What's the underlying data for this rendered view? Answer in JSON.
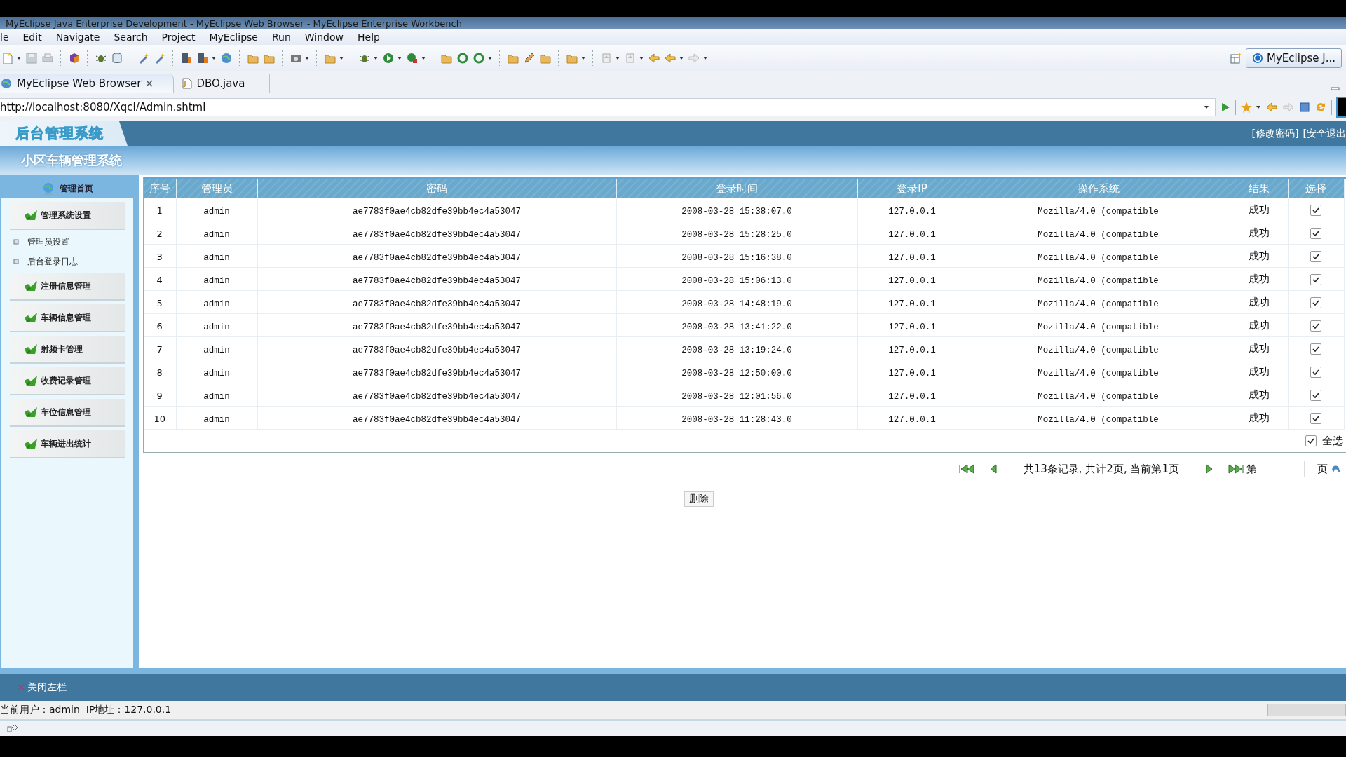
{
  "window": {
    "title": "MyEclipse Java Enterprise Development - MyEclipse Web Browser - MyEclipse Enterprise Workbench"
  },
  "menu": [
    "le",
    "Edit",
    "Navigate",
    "Search",
    "Project",
    "MyEclipse",
    "Run",
    "Window",
    "Help"
  ],
  "toolbar": {
    "perspective_button": "MyEclipse J..."
  },
  "tabs": [
    {
      "label": "MyEclipse Web Browser",
      "selected": true
    },
    {
      "label": "DBO.java",
      "selected": false
    }
  ],
  "address_bar": {
    "value": "http://localhost:8080/Xqcl/Admin.shtml"
  },
  "app": {
    "logo": "后台管理系统",
    "header_links": [
      "[修改密码]",
      "[安全退出"
    ],
    "subtitle": "小区车辆管理系统"
  },
  "sidebar": {
    "home": "管理首页",
    "items": [
      {
        "label": "管理系统设置",
        "children": [
          {
            "label": "管理员设置"
          },
          {
            "label": "后台登录日志"
          }
        ]
      },
      {
        "label": "注册信息管理"
      },
      {
        "label": "车辆信息管理"
      },
      {
        "label": "射频卡管理"
      },
      {
        "label": "收费记录管理"
      },
      {
        "label": "车位信息管理"
      },
      {
        "label": "车辆进出统计"
      }
    ]
  },
  "table": {
    "columns": [
      "序号",
      "管理员",
      "密码",
      "登录时间",
      "登录IP",
      "操作系统",
      "结果",
      "选择"
    ],
    "rows": [
      {
        "cells": [
          "1",
          "admin",
          "ae7783f0ae4cb82dfe39bb4ec4a53047",
          "2008-03-28 15:38:07.0",
          "127.0.0.1",
          "Mozilla/4.0 (compatible",
          "成功"
        ],
        "checked": true
      },
      {
        "cells": [
          "2",
          "admin",
          "ae7783f0ae4cb82dfe39bb4ec4a53047",
          "2008-03-28 15:28:25.0",
          "127.0.0.1",
          "Mozilla/4.0 (compatible",
          "成功"
        ],
        "checked": true
      },
      {
        "cells": [
          "3",
          "admin",
          "ae7783f0ae4cb82dfe39bb4ec4a53047",
          "2008-03-28 15:16:38.0",
          "127.0.0.1",
          "Mozilla/4.0 (compatible",
          "成功"
        ],
        "checked": true
      },
      {
        "cells": [
          "4",
          "admin",
          "ae7783f0ae4cb82dfe39bb4ec4a53047",
          "2008-03-28 15:06:13.0",
          "127.0.0.1",
          "Mozilla/4.0 (compatible",
          "成功"
        ],
        "checked": true
      },
      {
        "cells": [
          "5",
          "admin",
          "ae7783f0ae4cb82dfe39bb4ec4a53047",
          "2008-03-28 14:48:19.0",
          "127.0.0.1",
          "Mozilla/4.0 (compatible",
          "成功"
        ],
        "checked": true
      },
      {
        "cells": [
          "6",
          "admin",
          "ae7783f0ae4cb82dfe39bb4ec4a53047",
          "2008-03-28 13:41:22.0",
          "127.0.0.1",
          "Mozilla/4.0 (compatible",
          "成功"
        ],
        "checked": true
      },
      {
        "cells": [
          "7",
          "admin",
          "ae7783f0ae4cb82dfe39bb4ec4a53047",
          "2008-03-28 13:19:24.0",
          "127.0.0.1",
          "Mozilla/4.0 (compatible",
          "成功"
        ],
        "checked": true
      },
      {
        "cells": [
          "8",
          "admin",
          "ae7783f0ae4cb82dfe39bb4ec4a53047",
          "2008-03-28 12:50:00.0",
          "127.0.0.1",
          "Mozilla/4.0 (compatible",
          "成功"
        ],
        "checked": true
      },
      {
        "cells": [
          "9",
          "admin",
          "ae7783f0ae4cb82dfe39bb4ec4a53047",
          "2008-03-28 12:01:56.0",
          "127.0.0.1",
          "Mozilla/4.0 (compatible",
          "成功"
        ],
        "checked": true
      },
      {
        "cells": [
          "10",
          "admin",
          "ae7783f0ae4cb82dfe39bb4ec4a53047",
          "2008-03-28 11:28:43.0",
          "127.0.0.1",
          "Mozilla/4.0 (compatible",
          "成功"
        ],
        "checked": true
      }
    ],
    "select_all": {
      "label": "全选",
      "checked": true
    }
  },
  "pagination": {
    "summary": "共13条记录, 共计2页, 当前第1页",
    "page_prefix": "第",
    "page_suffix": "页"
  },
  "delete_button": "删除",
  "footer": {
    "close_sidebar": "关闭左栏",
    "status": "当前用户：admin  IP地址：127.0.0.1"
  }
}
